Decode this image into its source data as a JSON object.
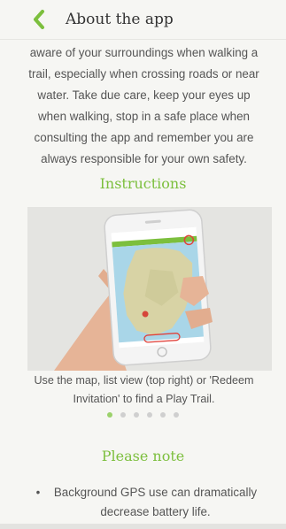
{
  "header": {
    "back_icon": "chevron-left-icon",
    "title": "About the app",
    "accent_color": "#7cbf3d"
  },
  "intro_lines": [
    "aware of your surroundings when walking a",
    "trail, especially when crossing roads or near",
    "water. Take due care, keep your eyes up",
    "when walking, stop in a safe place when",
    "consulting the app and remember you are",
    "always responsible for your own safety."
  ],
  "instructions": {
    "heading": "Instructions",
    "image_icon": "hand-holding-phone-map-illustration",
    "caption_lines": [
      "Use the map, list view (top right) or 'Redeem",
      "Invitation' to find a Play Trail."
    ],
    "carousel": {
      "dot_count": 6,
      "active_index": 0
    }
  },
  "please_note": {
    "heading": "Please note",
    "bullet": "•",
    "items": [
      "Background GPS use can dramatically decrease battery life."
    ]
  }
}
